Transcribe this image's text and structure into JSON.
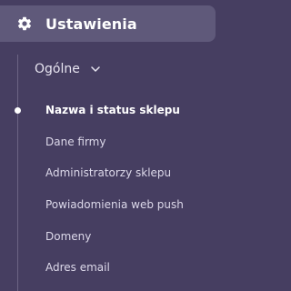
{
  "header": {
    "icon": "gear-icon",
    "label": "Ustawienia"
  },
  "group": {
    "label": "Ogólne",
    "icon": "chevron-down-icon"
  },
  "items": [
    {
      "label": "Nazwa i status sklepu",
      "active": true
    },
    {
      "label": "Dane firmy",
      "active": false
    },
    {
      "label": "Administratorzy sklepu",
      "active": false
    },
    {
      "label": "Powiadomienia web push",
      "active": false
    },
    {
      "label": "Domeny",
      "active": false
    },
    {
      "label": "Adres email",
      "active": false
    }
  ],
  "colors": {
    "background": "#463e61",
    "header_background": "#5f597a",
    "text": "#ddd9ea",
    "active_text": "#ffffff"
  }
}
